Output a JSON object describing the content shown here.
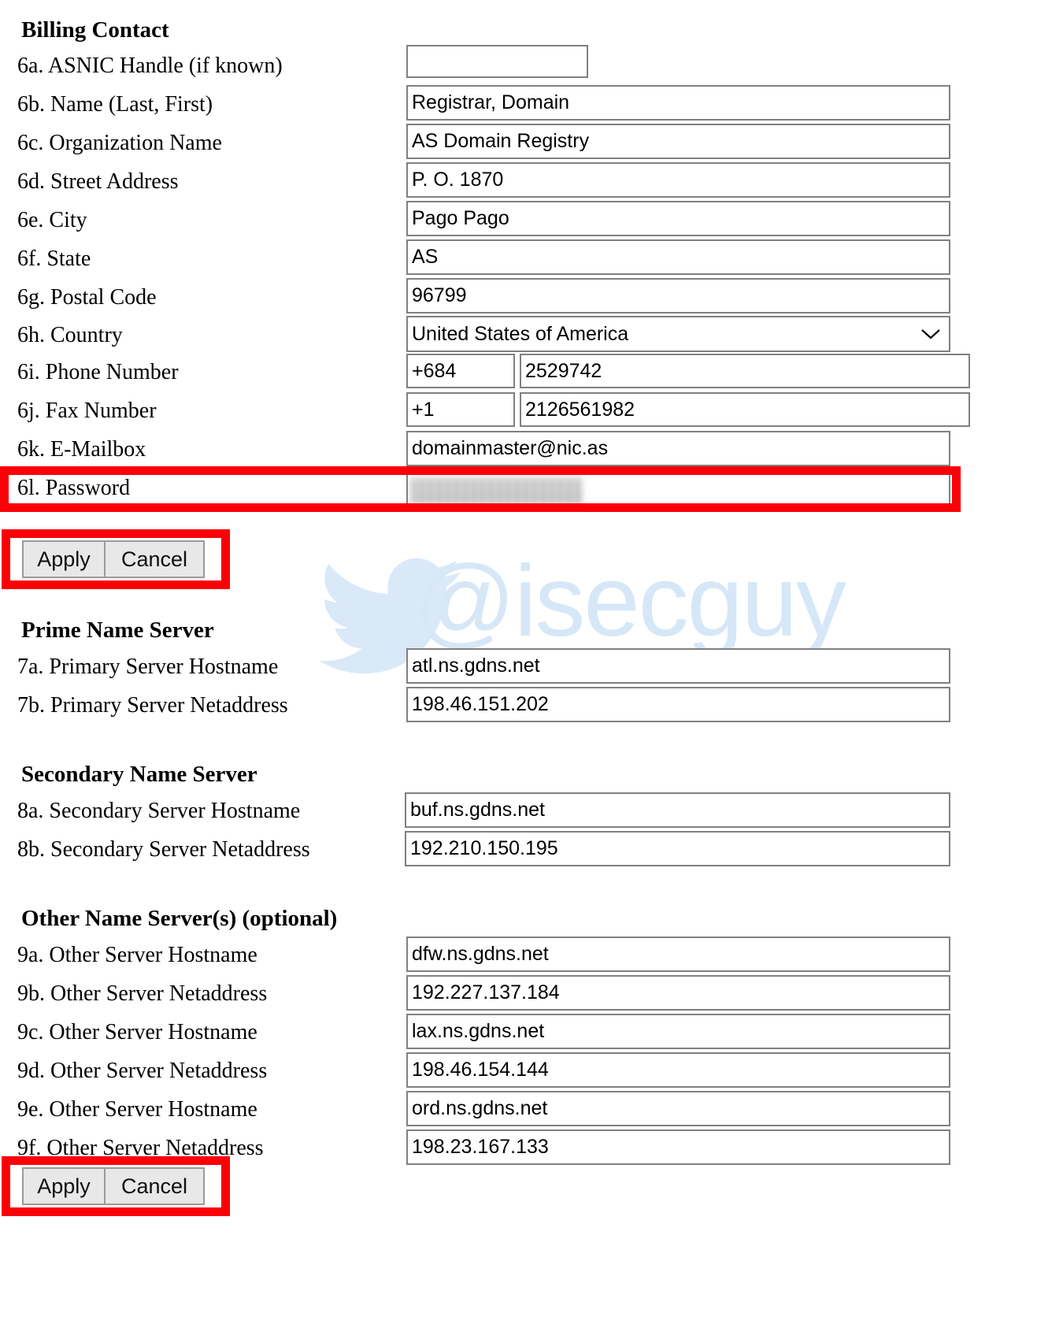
{
  "watermark": {
    "handle": "@isecguy",
    "bird_color": "#d9e9f8",
    "text_color": "#d6e7f7"
  },
  "accent": {
    "highlight": "#fb0007",
    "field_border": "#808080",
    "button_face": "#e8e8e8"
  },
  "billing_contact": {
    "title": "Billing Contact",
    "rows": [
      {
        "label": "6a. ASNIC Handle (if known)",
        "value": "",
        "type": "text"
      },
      {
        "label": "6b. Name (Last, First)",
        "value": "Registrar, Domain",
        "type": "text"
      },
      {
        "label": "6c. Organization Name",
        "value": "AS Domain Registry",
        "type": "text"
      },
      {
        "label": "6d. Street Address",
        "value": "P. O. 1870",
        "type": "text"
      },
      {
        "label": "6e. City",
        "value": "Pago Pago",
        "type": "text"
      },
      {
        "label": "6f. State",
        "value": "AS",
        "type": "text"
      },
      {
        "label": "6g. Postal Code",
        "value": "96799",
        "type": "text"
      },
      {
        "label": "6h. Country",
        "value": "United States of America",
        "type": "select",
        "icon": "chevron-down-icon"
      },
      {
        "label": "6i. Phone Number",
        "country_code": "+684",
        "number": "2529742",
        "type": "phone"
      },
      {
        "label": "6j. Fax Number",
        "country_code": "+1",
        "number": "2126561982",
        "type": "phone"
      },
      {
        "label": "6k. E-Mailbox",
        "value": "domainmaster@nic.as",
        "type": "text"
      },
      {
        "label": "6l. Password",
        "value": "",
        "type": "password",
        "redacted": true
      }
    ]
  },
  "buttons_top": {
    "apply": "Apply",
    "cancel": "Cancel"
  },
  "buttons_bottom": {
    "apply": "Apply",
    "cancel": "Cancel"
  },
  "prime_name_server": {
    "title": "Prime Name Server",
    "rows": [
      {
        "label": "7a. Primary Server Hostname",
        "value": "atl.ns.gdns.net"
      },
      {
        "label": "7b. Primary Server Netaddress",
        "value": "198.46.151.202"
      }
    ]
  },
  "secondary_name_server": {
    "title": "Secondary Name Server",
    "rows": [
      {
        "label": "8a. Secondary Server Hostname",
        "value": "buf.ns.gdns.net"
      },
      {
        "label": "8b. Secondary Server Netaddress",
        "value": "192.210.150.195"
      }
    ]
  },
  "other_name_servers": {
    "title": "Other Name Server(s) (optional)",
    "rows": [
      {
        "label": "9a. Other Server Hostname",
        "value": "dfw.ns.gdns.net"
      },
      {
        "label": "9b. Other Server Netaddress",
        "value": "192.227.137.184"
      },
      {
        "label": "9c. Other Server Hostname",
        "value": "lax.ns.gdns.net"
      },
      {
        "label": "9d. Other Server Netaddress",
        "value": "198.46.154.144"
      },
      {
        "label": "9e. Other Server Hostname",
        "value": "ord.ns.gdns.net"
      },
      {
        "label": "9f. Other Server Netaddress",
        "value": "198.23.167.133"
      }
    ]
  }
}
